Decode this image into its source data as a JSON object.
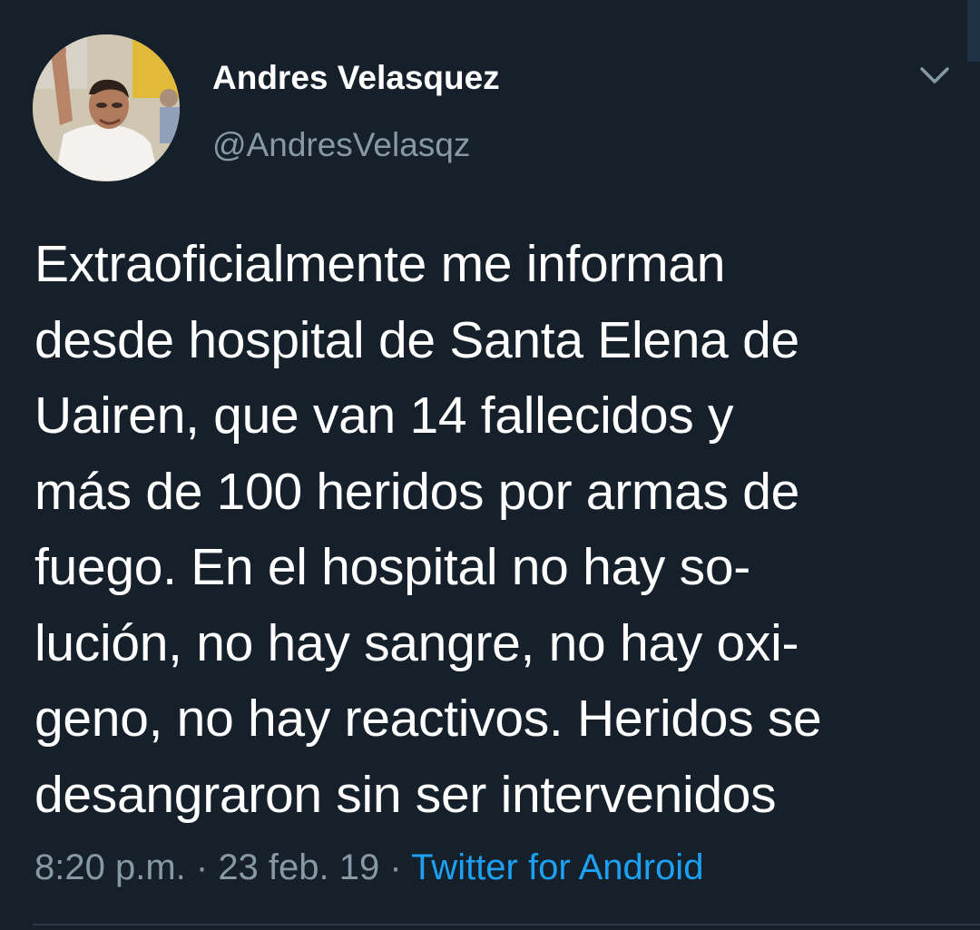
{
  "tweet": {
    "author": {
      "display_name": "Andres Velasquez",
      "handle": "@AndresVelasqz"
    },
    "text": "Extraoficialmente me informan\ndesde hospital de Santa Elena de\nUairen, que van 14 fallecidos y\nmás de 100 heridos por armas de\nfuego. En el hospital no hay so-\nlución, no hay sangre, no hay oxi-\ngeno, no hay reactivos. Heridos se\ndesangraron sin ser intervenidos",
    "time": "8:20 p.m.",
    "separator": " · ",
    "date": "23 feb. 19",
    "source": "Twitter for Android"
  },
  "icons": {
    "menu": "chevron-down-icon",
    "avatar": "avatar"
  },
  "colors": {
    "background": "#15202b",
    "text_primary": "#ffffff",
    "text_secondary": "#8899a6",
    "link": "#1da1f2",
    "divider": "#2b3a49"
  }
}
